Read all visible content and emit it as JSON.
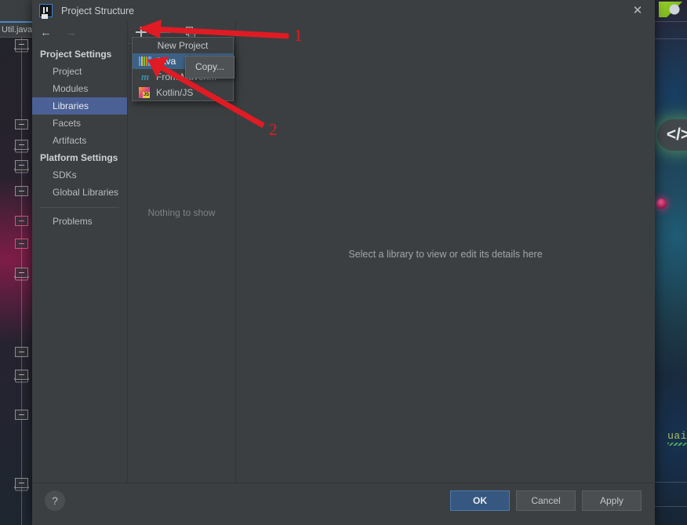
{
  "background": {
    "editor_tab": "Util.java",
    "code_badge": "</>",
    "right_code_text": "uai"
  },
  "dialog": {
    "title": "Project Structure",
    "logo_icon": "intellij-idea-logo-icon",
    "close_icon": "close-icon"
  },
  "nav": {
    "back_icon": "arrow-left-icon",
    "forward_icon": "arrow-right-icon",
    "groups": [
      {
        "label": "Project Settings",
        "items": [
          {
            "label": "Project",
            "selected": false
          },
          {
            "label": "Modules",
            "selected": false
          },
          {
            "label": "Libraries",
            "selected": true
          },
          {
            "label": "Facets",
            "selected": false
          },
          {
            "label": "Artifacts",
            "selected": false
          }
        ]
      },
      {
        "label": "Platform Settings",
        "items": [
          {
            "label": "SDKs",
            "selected": false
          },
          {
            "label": "Global Libraries",
            "selected": false
          }
        ]
      }
    ],
    "problems_label": "Problems"
  },
  "list_panel": {
    "toolbar": {
      "add_icon": "plus-icon",
      "remove_icon": "minus-icon",
      "copy_icon": "copy-icon"
    },
    "empty_message": "Nothing to show"
  },
  "popup_menu": {
    "header": "New Project",
    "items": [
      {
        "label": "Java",
        "icon": "java-library-icon",
        "highlighted": true
      },
      {
        "label": "From Maven...",
        "icon": "maven-icon",
        "highlighted": false
      },
      {
        "label": "Kotlin/JS",
        "icon": "kotlin-js-icon",
        "highlighted": false
      }
    ]
  },
  "tooltip": {
    "copy_label": "Copy..."
  },
  "detail_panel": {
    "message": "Select a library to view or edit its details here"
  },
  "footer": {
    "help_label": "?",
    "ok_label": "OK",
    "cancel_label": "Cancel",
    "apply_label": "Apply"
  },
  "annotations": {
    "marker_1": "1",
    "marker_2": "2",
    "color": "#e01b24"
  }
}
